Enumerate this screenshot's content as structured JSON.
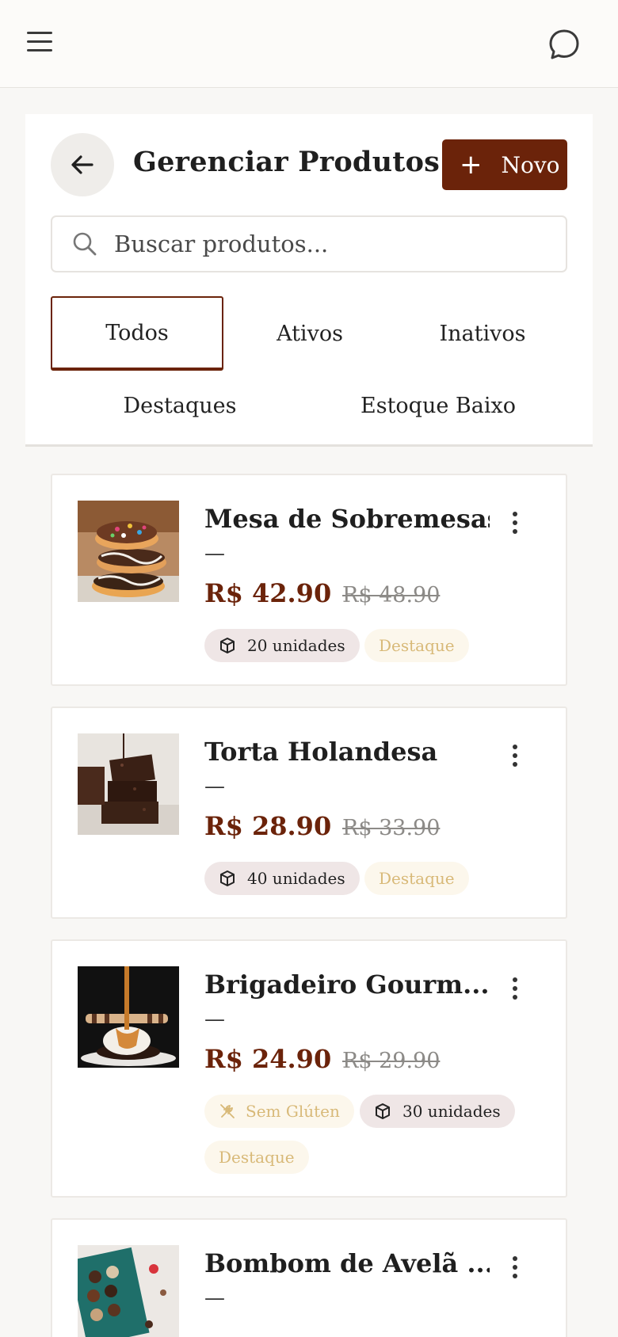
{
  "header": {
    "menu_icon": "hamburger-menu-icon",
    "chat_icon": "chat-bubble-icon"
  },
  "page": {
    "title": "Gerenciar Produtos",
    "new_button": "Novo",
    "search_placeholder": "Buscar produtos..."
  },
  "tabs": {
    "todos": "Todos",
    "ativos": "Ativos",
    "inativos": "Inativos",
    "destaques": "Destaques",
    "estoque_baixo": "Estoque Baixo",
    "selected": "Todos"
  },
  "products": [
    {
      "name": "Mesa de Sobremesas",
      "subtitle": "—",
      "price": "R$ 42.90",
      "old_price": "R$ 48.90",
      "stock": "20 unidades",
      "featured": "Destaque"
    },
    {
      "name": "Torta Holandesa",
      "subtitle": "—",
      "price": "R$ 28.90",
      "old_price": "R$ 33.90",
      "stock": "40 unidades",
      "featured": "Destaque"
    },
    {
      "name": "Brigadeiro Gourm...",
      "subtitle": "—",
      "price": "R$ 24.90",
      "old_price": "R$ 29.90",
      "gluten": "Sem Glúten",
      "stock": "30 unidades",
      "featured": "Destaque"
    },
    {
      "name": "Bombom de Avelã ...",
      "subtitle": "—"
    }
  ],
  "colors": {
    "accent": "#6b230a",
    "featured_text": "#d8b978",
    "stock_chip_bg": "#efe6e6"
  }
}
